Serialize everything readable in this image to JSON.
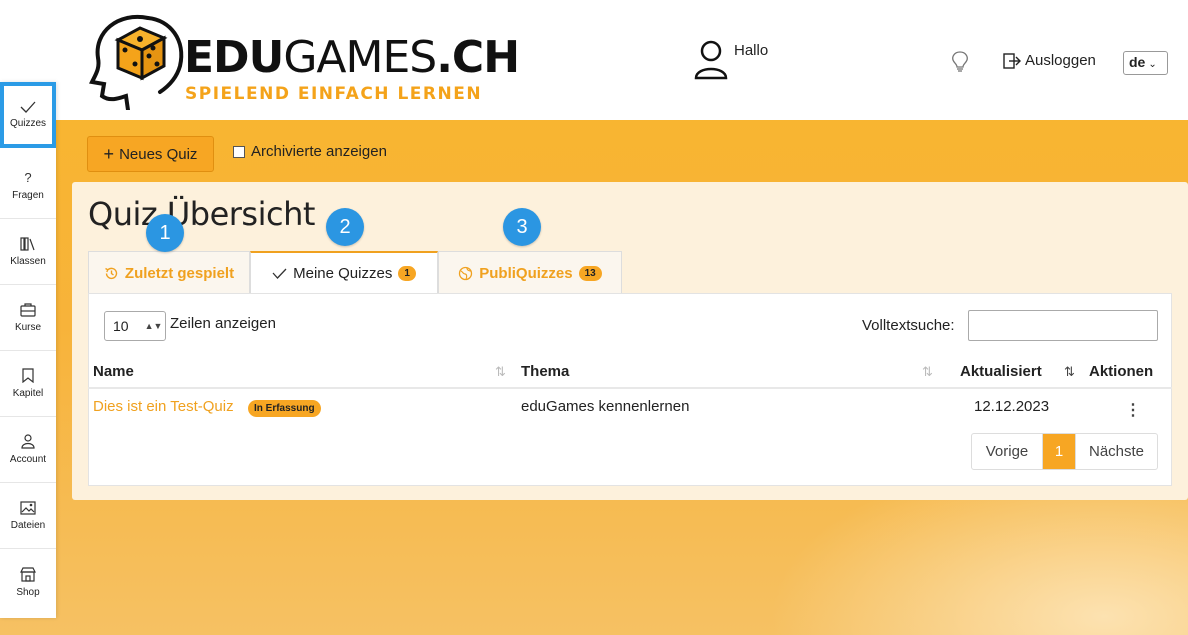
{
  "brand": {
    "title_bold": "EDU",
    "title_light": "GAMES",
    "title_suffix": ".CH",
    "tagline": "SPIELEND EINFACH LERNEN"
  },
  "header": {
    "greeting": "Hallo",
    "logout_label": "Ausloggen",
    "language": "de"
  },
  "sidebar": {
    "items": [
      {
        "label": "Quizzes",
        "icon": "check-icon",
        "active": true
      },
      {
        "label": "Fragen",
        "icon": "question-icon"
      },
      {
        "label": "Klassen",
        "icon": "books-icon"
      },
      {
        "label": "Kurse",
        "icon": "briefcase-icon"
      },
      {
        "label": "Kapitel",
        "icon": "bookmark-icon"
      },
      {
        "label": "Account",
        "icon": "user-icon"
      },
      {
        "label": "Dateien",
        "icon": "image-icon"
      },
      {
        "label": "Shop",
        "icon": "shop-icon"
      }
    ]
  },
  "toolbar": {
    "new_quiz_label": "Neues Quiz",
    "archived_label": "Archivierte anzeigen"
  },
  "page": {
    "title": "Quiz Übersicht"
  },
  "tabs": [
    {
      "label": "Zuletzt gespielt",
      "icon": "history-icon"
    },
    {
      "label": "Meine Quizzes",
      "icon": "check-icon",
      "count": "1",
      "active": true
    },
    {
      "label": "PubliQuizzes",
      "icon": "globe-icon",
      "count": "13"
    }
  ],
  "callouts": [
    "1",
    "2",
    "3"
  ],
  "table": {
    "length_value": "10",
    "length_label": "Zeilen anzeigen",
    "search_label": "Volltextsuche:",
    "search_value": "",
    "columns": [
      "Name",
      "Thema",
      "Aktualisiert",
      "Aktionen"
    ],
    "rows": [
      {
        "name": "Dies ist ein Test-Quiz",
        "status": "In Erfassung",
        "topic": "eduGames kennenlernen",
        "updated": "12.12.2023",
        "actions": "⋮"
      }
    ],
    "pagination": {
      "prev_label": "Vorige",
      "current_page": "1",
      "next_label": "Nächste"
    }
  },
  "colors": {
    "accent": "#f7a623",
    "callout": "#2b96e2",
    "active_outline": "#2b9be6"
  }
}
